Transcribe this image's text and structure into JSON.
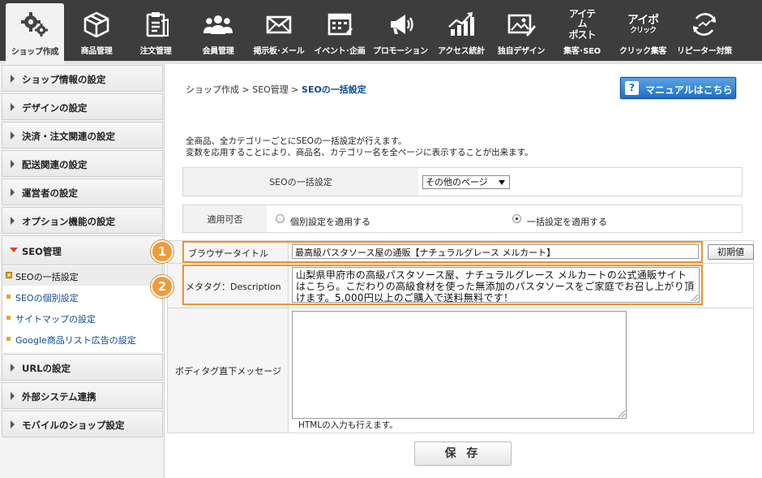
{
  "nav": [
    {
      "label": "ショップ作成",
      "icon": "gears-icon",
      "active": true
    },
    {
      "label": "商品管理",
      "icon": "box-icon"
    },
    {
      "label": "注文管理",
      "icon": "clipboard-icon"
    },
    {
      "label": "会員管理",
      "icon": "users-icon"
    },
    {
      "label": "掲示板･メール",
      "icon": "mail-icon"
    },
    {
      "label": "イベント･企画",
      "icon": "calendar-icon"
    },
    {
      "label": "プロモーション",
      "icon": "megaphone-icon"
    },
    {
      "label": "アクセス統計",
      "icon": "chart-icon"
    },
    {
      "label": "独自デザイン",
      "icon": "image-edit-icon"
    },
    {
      "label": "集客･SEO",
      "icon": "item-post-logo",
      "logo_lines": [
        "アイテム",
        "ポスト"
      ]
    },
    {
      "label": "クリック集客",
      "icon": "aipo-click-logo",
      "logo_lines": [
        "アイポ",
        "クリック"
      ]
    },
    {
      "label": "リピーター対策",
      "icon": "repeat-smile-icon"
    }
  ],
  "sidebar": {
    "items": [
      {
        "label": "ショップ情報の設定"
      },
      {
        "label": "デザインの設定"
      },
      {
        "label": "決済・注文関連の設定"
      },
      {
        "label": "配送関連の設定"
      },
      {
        "label": "運営者の設定"
      },
      {
        "label": "オプション機能の設定"
      },
      {
        "label": "SEO管理",
        "expanded": true
      },
      {
        "label": "URLの設定"
      },
      {
        "label": "外部システム連携"
      },
      {
        "label": "モバイルのショップ設定"
      }
    ],
    "sub_items": [
      {
        "label": "SEOの一括設定",
        "current": true
      },
      {
        "label": "SEOの個別設定"
      },
      {
        "label": "サイトマップの設定"
      },
      {
        "label": "Google商品リスト広告の設定"
      }
    ]
  },
  "breadcrumb": {
    "path": "ショップ作成 > SEO管理 > ",
    "current": "SEOの一括設定"
  },
  "manual_button": {
    "q": "?",
    "label": "マニュアルはこちら"
  },
  "intro": {
    "line1": "全商品、全カテゴリーごとにSEOの一括設定が行えます。",
    "line2": "変数を応用することにより、商品名、カテゴリー名を全ページに表示することが出来ます。"
  },
  "form": {
    "seo_setting_label": "SEOの一括設定",
    "page_select_value": "その他のページ",
    "apply_label": "適用可否",
    "radio_individual": "個別設定を適用する",
    "radio_bulk": "一括設定を適用する",
    "radio_selected": "bulk",
    "browser_title_label": "ブラウザータイトル",
    "browser_title_value": "最高級パスタソース屋の通販【ナチュラルグレース メルカート】",
    "reset_button": "初期値",
    "meta_label": "メタタグ：Description",
    "meta_value": "山梨県甲府市の高級パスタソース屋、ナチュラルグレース メルカートの公式通販サイトはこちら。こだわりの高級食材を使った無添加のパスタソースをご家庭でお召し上がり頂けます。5,000円以上のご購入で送料無料です！",
    "body_label": "ボディタグ直下メッセージ",
    "body_value": "",
    "html_note": "HTMLの入力も行えます。",
    "save_button": "保 存"
  },
  "badges": [
    "1",
    "2"
  ],
  "colors": {
    "accent": "#f0922d",
    "link": "#0b4a9a",
    "nav_bg": "#3d3d3d",
    "manual_btn": "#1e6fc7"
  }
}
